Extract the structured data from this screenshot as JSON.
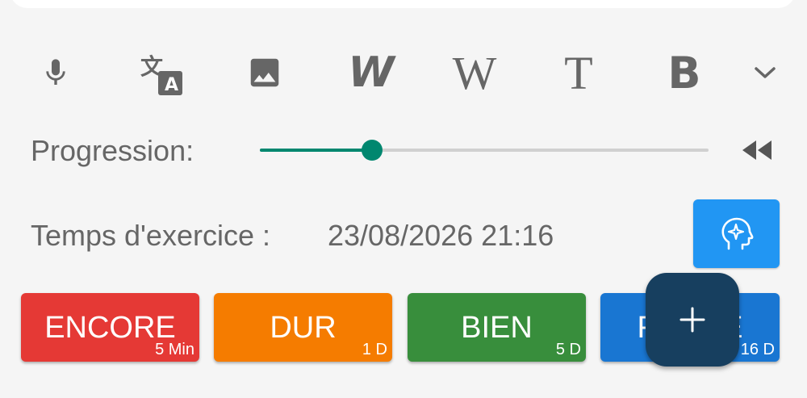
{
  "toolbar": {
    "icons": [
      "microphone-icon",
      "translate-icon",
      "image-icon",
      "wordreference-icon",
      "wikipedia-icon",
      "text-icon",
      "bing-icon",
      "chevron-down-icon"
    ],
    "wordreference_glyph": "W",
    "wikipedia_glyph": "W",
    "text_glyph": "T",
    "bing_glyph": "B",
    "icon_color": "#666666"
  },
  "progression": {
    "label": "Progression:",
    "value": 0.25,
    "accent": "#00876f",
    "rewind_icon": "rewind-icon"
  },
  "exercise": {
    "label": "Temps d'exercice :",
    "datetime": "23/08/2026 21:16",
    "ai_button_icon": "brain-sparkle-icon",
    "ai_button_color": "#2196f3"
  },
  "answers": [
    {
      "label": "ENCORE",
      "interval": "5 Min",
      "color": "#e53935"
    },
    {
      "label": "DUR",
      "interval": "1 D",
      "color": "#f57c00"
    },
    {
      "label": "BIEN",
      "interval": "5 D",
      "color": "#388e3c"
    },
    {
      "label": "FACILE",
      "interval": "16 D",
      "color": "#1976d2"
    }
  ],
  "fab": {
    "icon": "plus-icon",
    "color": "#173f5f"
  }
}
